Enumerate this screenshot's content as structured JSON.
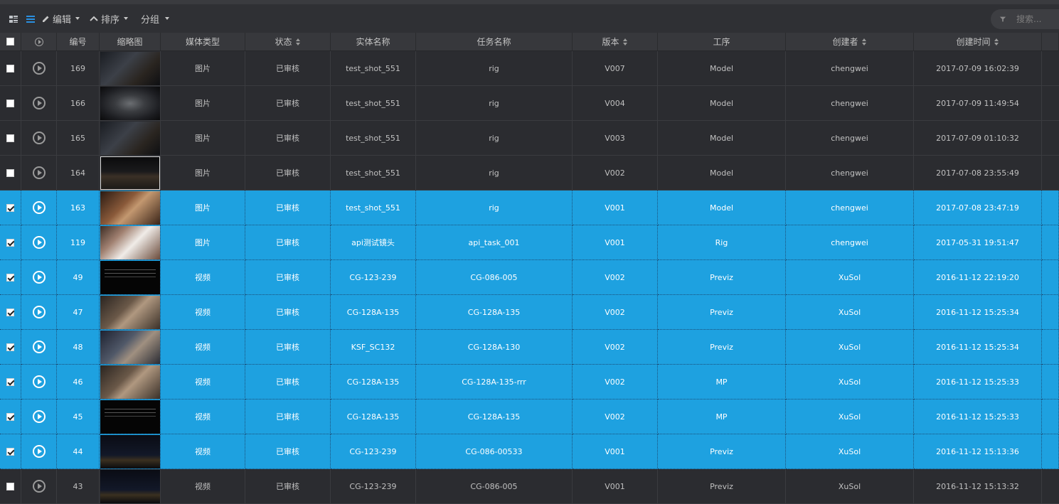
{
  "toolbar": {
    "edit_label": "编辑",
    "sort_label": "排序",
    "group_label": "分组",
    "search_placeholder": "搜索..."
  },
  "columns": {
    "id": "编号",
    "thumbnail": "缩略图",
    "media_type": "媒体类型",
    "status": "状态",
    "entity": "实体名称",
    "task": "任务名称",
    "version": "版本",
    "step": "工序",
    "creator": "创建者",
    "created": "创建时间"
  },
  "rows": [
    {
      "id": "169",
      "thumb": "dark",
      "media": "图片",
      "status": "已审核",
      "entity": "test_shot_551",
      "task": "rig",
      "version": "V007",
      "step": "Model",
      "creator": "chengwei",
      "created": "2017-07-09 16:02:39",
      "selected": false
    },
    {
      "id": "166",
      "thumb": "tunnel",
      "media": "图片",
      "status": "已审核",
      "entity": "test_shot_551",
      "task": "rig",
      "version": "V004",
      "step": "Model",
      "creator": "chengwei",
      "created": "2017-07-09 11:49:54",
      "selected": false
    },
    {
      "id": "165",
      "thumb": "dark",
      "media": "图片",
      "status": "已审核",
      "entity": "test_shot_551",
      "task": "rig",
      "version": "V003",
      "step": "Model",
      "creator": "chengwei",
      "created": "2017-07-09 01:10:32",
      "selected": false
    },
    {
      "id": "164",
      "thumb": "frame",
      "media": "图片",
      "status": "已审核",
      "entity": "test_shot_551",
      "task": "rig",
      "version": "V002",
      "step": "Model",
      "creator": "chengwei",
      "created": "2017-07-08 23:55:49",
      "selected": false
    },
    {
      "id": "163",
      "thumb": "warm",
      "media": "图片",
      "status": "已审核",
      "entity": "test_shot_551",
      "task": "rig",
      "version": "V001",
      "step": "Model",
      "creator": "chengwei",
      "created": "2017-07-08 23:47:19",
      "selected": true
    },
    {
      "id": "119",
      "thumb": "white",
      "media": "图片",
      "status": "已审核",
      "entity": "api测试镜头",
      "task": "api_task_001",
      "version": "V001",
      "step": "Rig",
      "creator": "chengwei",
      "created": "2017-05-31 19:51:47",
      "selected": true
    },
    {
      "id": "49",
      "thumb": "black",
      "media": "视频",
      "status": "已审核",
      "entity": "CG-123-239",
      "task": "CG-086-005",
      "version": "V002",
      "step": "Previz",
      "creator": "XuSol",
      "created": "2016-11-12 22:19:20",
      "selected": true
    },
    {
      "id": "47",
      "thumb": "fight",
      "media": "视频",
      "status": "已审核",
      "entity": "CG-128A-135",
      "task": "CG-128A-135",
      "version": "V002",
      "step": "Previz",
      "creator": "XuSol",
      "created": "2016-11-12 15:25:34",
      "selected": true
    },
    {
      "id": "48",
      "thumb": "fight2",
      "media": "视频",
      "status": "已审核",
      "entity": "KSF_SC132",
      "task": "CG-128A-130",
      "version": "V002",
      "step": "Previz",
      "creator": "XuSol",
      "created": "2016-11-12 15:25:34",
      "selected": true
    },
    {
      "id": "46",
      "thumb": "fight",
      "media": "视频",
      "status": "已审核",
      "entity": "CG-128A-135",
      "task": "CG-128A-135-rrr",
      "version": "V002",
      "step": "MP",
      "creator": "XuSol",
      "created": "2016-11-12 15:25:33",
      "selected": true
    },
    {
      "id": "45",
      "thumb": "black",
      "media": "视频",
      "status": "已审核",
      "entity": "CG-128A-135",
      "task": "CG-128A-135",
      "version": "V002",
      "step": "MP",
      "creator": "XuSol",
      "created": "2016-11-12 15:25:33",
      "selected": true
    },
    {
      "id": "44",
      "thumb": "night",
      "media": "视频",
      "status": "已审核",
      "entity": "CG-123-239",
      "task": "CG-086-00533",
      "version": "V001",
      "step": "Previz",
      "creator": "XuSol",
      "created": "2016-11-12 15:13:36",
      "selected": true
    },
    {
      "id": "43",
      "thumb": "night",
      "media": "视频",
      "status": "已审核",
      "entity": "CG-123-239",
      "task": "CG-086-005",
      "version": "V001",
      "step": "Previz",
      "creator": "XuSol",
      "created": "2016-11-12 15:13:32",
      "selected": false
    }
  ]
}
